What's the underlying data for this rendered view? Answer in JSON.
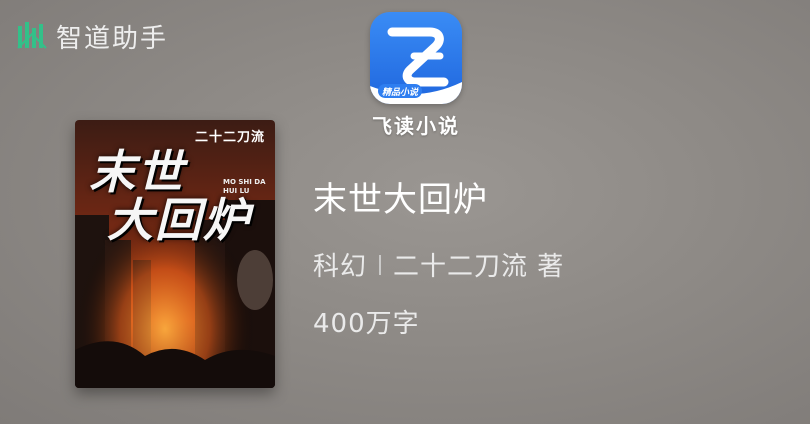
{
  "watermark": {
    "icon": "zhidao-logo-icon",
    "text": "智道助手"
  },
  "app": {
    "icon": "feidu-app-icon",
    "badge_text": "精品小说",
    "name": "飞读小说",
    "brand_color": "#2f7ef0"
  },
  "book": {
    "cover": {
      "author_tag": "二十二刀流",
      "title_line1": "末世",
      "title_line2": "大回炉",
      "pinyin": "MO SHI DA HUI LU"
    },
    "title": "末世大回炉",
    "genre": "科幻",
    "author_line": "二十二刀流 著",
    "word_count": "400万字"
  }
}
